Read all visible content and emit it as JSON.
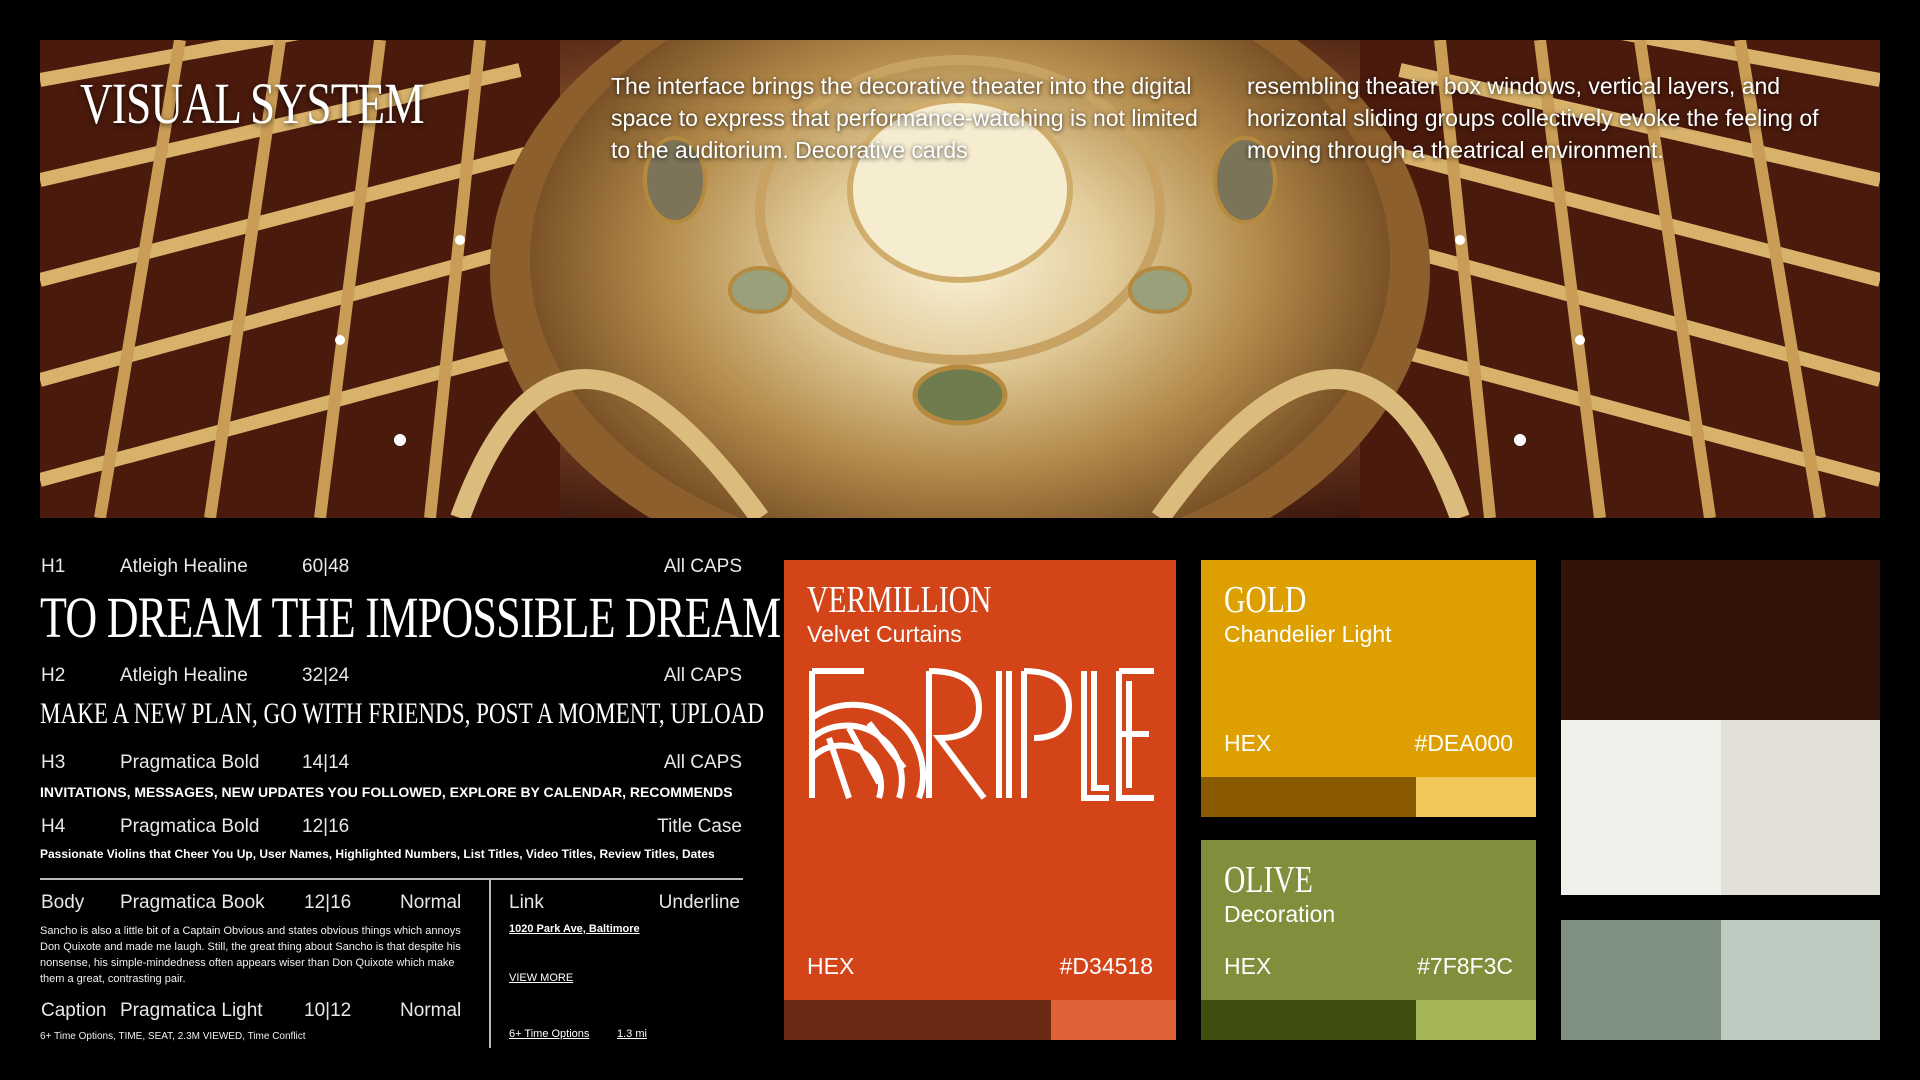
{
  "hero": {
    "title": "VISUAL SYSTEM",
    "paragraph_1": "The interface brings the decorative theater into the digital space to express that performance-watching is not limited to the auditorium. Decorative cards",
    "paragraph_2": "resembling theater box windows, vertical layers, and horizontal sliding groups collectively evoke the feeling of moving through a theatrical environment."
  },
  "type": {
    "h1": {
      "level": "H1",
      "font": "Atleigh Healine",
      "size": "60|48",
      "case": "All CAPS",
      "sample": "TO DREAM THE IMPOSSIBLE DREAM"
    },
    "h2": {
      "level": "H2",
      "font": "Atleigh Healine",
      "size": "32|24",
      "case": "All CAPS",
      "sample": "MAKE A NEW PLAN, GO WITH FRIENDS, POST A MOMENT, UPLOAD"
    },
    "h3": {
      "level": "H3",
      "font": "Pragmatica Bold",
      "size": "14|14",
      "case": "All CAPS",
      "sample": "INVITATIONS, MESSAGES, NEW UPDATES YOU FOLLOWED, EXPLORE BY CALENDAR, RECOMMENDS"
    },
    "h4": {
      "level": "H4",
      "font": "Pragmatica Bold",
      "size": "12|16",
      "case": "Title Case",
      "sample": "Passionate Violins that Cheer You Up, User Names, Highlighted Numbers, List Titles, Video Titles, Review Titles, Dates"
    },
    "body": {
      "level": "Body",
      "font": "Pragmatica Book",
      "size": "12|16",
      "case": "Normal",
      "sample": "Sancho is also a little bit of a Captain Obvious and states obvious things which annoys Don Quixote and made me laugh. Still, the great thing about Sancho is that despite his nonsense, his simple-mindedness often appears wiser than Don Quixote which make them a great, contrasting pair."
    },
    "caption": {
      "level": "Caption",
      "font": "Pragmatica Light",
      "size": "10|12",
      "case": "Normal",
      "sample": "6+ Time Options, TIME, SEAT, 2.3M VIEWED, Time Conflict"
    },
    "link": {
      "level": "Link",
      "case": "Underline",
      "sample_1": "1020 Park Ave, Baltimore",
      "sample_2": "VIEW MORE",
      "sample_3": "6+ Time Options",
      "sample_4": "1.3 mi"
    }
  },
  "colors": {
    "vermillion": {
      "name": "VERMILLION",
      "sub": "Velvet Curtains",
      "hex_label": "HEX",
      "hex": "#D34518",
      "shade_dark": "#6B2A14",
      "shade_light": "#DE6236",
      "logo_text": "RIPLE"
    },
    "gold": {
      "name": "GOLD",
      "sub": "Chandelier Light",
      "hex_label": "HEX",
      "hex": "#DEA000",
      "shade_dark": "#8A5A00",
      "shade_light": "#F2C75A"
    },
    "olive": {
      "name": "OLIVE",
      "sub": "Decoration",
      "hex_label": "HEX",
      "hex": "#7F8F3C",
      "shade_dark": "#3F4F12",
      "shade_light": "#A4B556"
    },
    "neutrals": [
      "#331209",
      "#F0F0EA",
      "#E2E0D9",
      "#7E9182",
      "#BDCBC1"
    ]
  }
}
